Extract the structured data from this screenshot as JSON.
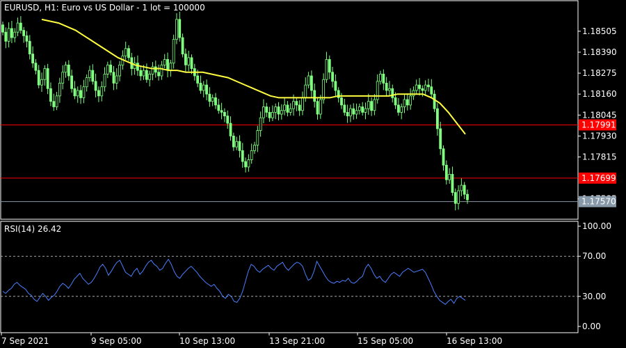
{
  "chart_data": [
    {
      "type": "candlestick",
      "title": "EURUSD, H1:  Euro vs US Dollar - 1 lot = 100000",
      "ylim": [
        1.175,
        1.186
      ],
      "y_ticks": [
        "1.18505",
        "1.18390",
        "1.18275",
        "1.18160",
        "1.18045",
        "1.17930",
        "1.17815",
        "1.17585"
      ],
      "x_ticks": [
        "7 Sep 2021",
        "9 Sep 05:00",
        "10 Sep 13:00",
        "13 Sep 21:00",
        "15 Sep 05:00",
        "16 Sep 13:00"
      ],
      "close_series": [
        1.185,
        1.1845,
        1.1852,
        1.1847,
        1.185,
        1.1855,
        1.1851,
        1.1848,
        1.1845,
        1.1838,
        1.1833,
        1.1829,
        1.1821,
        1.1824,
        1.183,
        1.1819,
        1.1812,
        1.1809,
        1.1815,
        1.1822,
        1.1828,
        1.1832,
        1.1826,
        1.1819,
        1.1815,
        1.1818,
        1.1814,
        1.182,
        1.1825,
        1.1829,
        1.1823,
        1.1818,
        1.1815,
        1.182,
        1.1827,
        1.1832,
        1.1828,
        1.1822,
        1.1826,
        1.1832,
        1.1837,
        1.1841,
        1.1836,
        1.183,
        1.1833,
        1.1829,
        1.1826,
        1.1829,
        1.1824,
        1.1827,
        1.1831,
        1.1828,
        1.1826,
        1.1832,
        1.1835,
        1.1829,
        1.1833,
        1.1846,
        1.1857,
        1.1847,
        1.1838,
        1.1832,
        1.1836,
        1.183,
        1.1826,
        1.1822,
        1.1818,
        1.1821,
        1.1816,
        1.1812,
        1.1814,
        1.181,
        1.1807,
        1.1806,
        1.1804,
        1.18,
        1.1793,
        1.1787,
        1.179,
        1.1785,
        1.1779,
        1.1776,
        1.178,
        1.1785,
        1.1788,
        1.1796,
        1.1803,
        1.1809,
        1.1806,
        1.1803,
        1.1806,
        1.1809,
        1.1805,
        1.1807,
        1.181,
        1.1806,
        1.1808,
        1.1812,
        1.181,
        1.1807,
        1.1814,
        1.1821,
        1.1826,
        1.1818,
        1.1812,
        1.1805,
        1.1813,
        1.1824,
        1.1835,
        1.1828,
        1.1823,
        1.1818,
        1.1814,
        1.181,
        1.1806,
        1.1804,
        1.1808,
        1.1805,
        1.1807,
        1.1809,
        1.1806,
        1.1808,
        1.1812,
        1.1807,
        1.1813,
        1.1823,
        1.1827,
        1.1822,
        1.1818,
        1.1819,
        1.1814,
        1.181,
        1.1806,
        1.1809,
        1.1813,
        1.181,
        1.1815,
        1.1818,
        1.1821,
        1.1819,
        1.1818,
        1.1821,
        1.182,
        1.1816,
        1.1808,
        1.1797,
        1.1786,
        1.1777,
        1.1769,
        1.1772,
        1.1762,
        1.1756,
        1.1763,
        1.1766,
        1.1761,
        1.1758
      ],
      "ma_series": [
        1.1857,
        1.1856,
        1.1855,
        1.1853,
        1.1851,
        1.1848,
        1.1845,
        1.1842,
        1.1839,
        1.1836,
        1.1834,
        1.1832,
        1.1831,
        1.183,
        1.183,
        1.1829,
        1.1829,
        1.1828,
        1.1828,
        1.1828,
        1.1827,
        1.1826,
        1.1825,
        1.1823,
        1.1821,
        1.1819,
        1.1817,
        1.1815,
        1.1814,
        1.1814,
        1.1814,
        1.1814,
        1.1814,
        1.1814,
        1.1814,
        1.1815,
        1.1815,
        1.1815,
        1.1815,
        1.1815,
        1.1815,
        1.1815,
        1.1816,
        1.1816,
        1.1816,
        1.1816,
        1.1814,
        1.1811,
        1.1806,
        1.18,
        1.1794
      ],
      "price_levels": [
        {
          "label": "1.17991",
          "value": 1.17991,
          "color": "#ff0000"
        },
        {
          "label": "1.17699",
          "value": 1.17699,
          "color": "#ff0000"
        },
        {
          "label": "1.17570",
          "value": 1.1757,
          "color": "#8899aa"
        }
      ],
      "colors": {
        "candles": "#80ff80",
        "ma": "#ffff40",
        "background": "#000000",
        "grid_frame": "#ffffff"
      }
    },
    {
      "type": "line",
      "title": "RSI(14) 26.42",
      "ylim": [
        0,
        100
      ],
      "y_ticks": [
        "100.00",
        "70.00",
        "30.00",
        "0.00"
      ],
      "levels": [
        70,
        30
      ],
      "values": [
        35,
        33,
        36,
        38,
        42,
        44,
        41,
        39,
        37,
        33,
        31,
        27,
        25,
        29,
        33,
        30,
        26,
        29,
        31,
        35,
        40,
        43,
        41,
        38,
        42,
        47,
        50,
        53,
        48,
        45,
        42,
        44,
        48,
        53,
        59,
        62,
        58,
        51,
        55,
        60,
        64,
        66,
        60,
        54,
        52,
        50,
        55,
        58,
        52,
        55,
        60,
        64,
        66,
        62,
        60,
        56,
        58,
        63,
        67,
        62,
        55,
        50,
        48,
        52,
        55,
        58,
        60,
        57,
        54,
        50,
        47,
        44,
        42,
        40,
        42,
        38,
        35,
        30,
        28,
        32,
        30,
        25,
        24,
        28,
        35,
        45,
        55,
        62,
        60,
        56,
        54,
        57,
        59,
        61,
        58,
        56,
        60,
        62,
        64,
        59,
        56,
        59,
        62,
        64,
        63,
        60,
        52,
        46,
        48,
        55,
        65,
        60,
        55,
        50,
        46,
        44,
        43,
        45,
        44,
        46,
        45,
        48,
        44,
        43,
        45,
        48,
        50,
        58,
        62,
        58,
        52,
        48,
        50,
        46,
        44,
        48,
        52,
        54,
        52,
        50,
        54,
        56,
        58,
        56,
        54,
        55,
        56,
        57,
        54,
        48,
        42,
        35,
        30,
        26,
        24,
        22,
        25,
        27,
        23,
        28,
        30,
        28,
        26
      ],
      "colors": {
        "line": "#4a80ff",
        "levels": "#aaaaaa"
      }
    }
  ]
}
